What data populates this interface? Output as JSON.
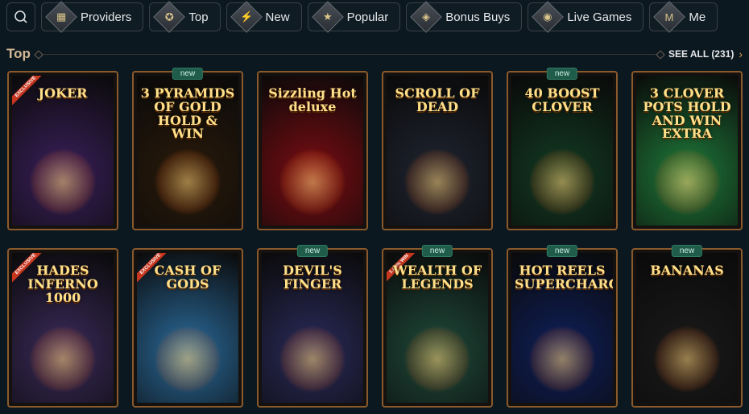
{
  "nav": {
    "search_icon": "search-icon",
    "items": [
      {
        "label": "Providers",
        "icon": "providers-icon",
        "glyph": "▦"
      },
      {
        "label": "Top",
        "icon": "top-icon",
        "glyph": "✪"
      },
      {
        "label": "New",
        "icon": "new-icon",
        "glyph": "⚡"
      },
      {
        "label": "Popular",
        "icon": "popular-icon",
        "glyph": "★"
      },
      {
        "label": "Bonus Buys",
        "icon": "bonus-buys-icon",
        "glyph": "◈"
      },
      {
        "label": "Live Games",
        "icon": "live-games-icon",
        "glyph": "◉"
      },
      {
        "label": "Me",
        "icon": "more-icon",
        "glyph": "M"
      }
    ]
  },
  "section": {
    "title": "Top",
    "see_all": "SEE ALL (231)"
  },
  "games": [
    {
      "title": "JOKER",
      "badge": "",
      "ribbon": "EXCLUSIVE",
      "bg": "#3a1f5a"
    },
    {
      "title": "3 PYRAMIDS OF GOLD HOLD & WIN",
      "badge": "new",
      "ribbon": "",
      "bg": "#2a1a0a"
    },
    {
      "title": "Sizzling Hot deluxe",
      "badge": "",
      "ribbon": "",
      "bg": "#7a0c12"
    },
    {
      "title": "SCROLL OF DEAD",
      "badge": "",
      "ribbon": "",
      "bg": "#1f2430"
    },
    {
      "title": "40 BOOST CLOVER",
      "badge": "new",
      "ribbon": "",
      "bg": "#123a22"
    },
    {
      "title": "3 CLOVER POTS HOLD AND WIN EXTRA",
      "badge": "",
      "ribbon": "",
      "bg": "#1f7a3a"
    },
    {
      "title": "HADES INFERNO 1000",
      "badge": "",
      "ribbon": "EXCLUSIVE",
      "bg": "#3a2a5a"
    },
    {
      "title": "CASH OF GODS",
      "badge": "",
      "ribbon": "EXCLUSIVE",
      "bg": "#2a6a9a"
    },
    {
      "title": "DEVIL'S FINGER",
      "badge": "new",
      "ribbon": "",
      "bg": "#2a2a5a"
    },
    {
      "title": "WEALTH OF LEGENDS",
      "badge": "new",
      "ribbon": "1.4K% WIN",
      "bg": "#1f4a3a"
    },
    {
      "title": "HOT REELS SUPERCHARGED",
      "badge": "new",
      "ribbon": "",
      "bg": "#0f1f5a"
    },
    {
      "title": "BANANAS",
      "badge": "new",
      "ribbon": "",
      "bg": "#1a1a1a"
    }
  ]
}
